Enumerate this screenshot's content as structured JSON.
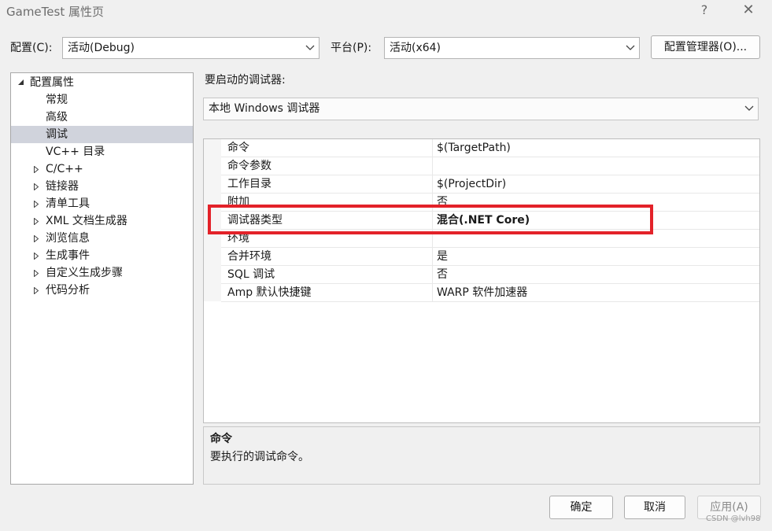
{
  "window": {
    "title": "GameTest 属性页",
    "help_glyph": "?",
    "close_glyph": "✕"
  },
  "toolbar": {
    "config_label": "配置(C):",
    "config_value": "活动(Debug)",
    "platform_label": "平台(P):",
    "platform_value": "活动(x64)",
    "config_manager_label": "配置管理器(O)..."
  },
  "tree": {
    "items": [
      {
        "label": "配置属性",
        "expander": "expanded"
      },
      {
        "label": "常规",
        "expander": "none"
      },
      {
        "label": "高级",
        "expander": "none"
      },
      {
        "label": "调试",
        "expander": "none",
        "selected": true
      },
      {
        "label": "VC++ 目录",
        "expander": "none"
      },
      {
        "label": "C/C++",
        "expander": "collapsed"
      },
      {
        "label": "链接器",
        "expander": "collapsed"
      },
      {
        "label": "清单工具",
        "expander": "collapsed"
      },
      {
        "label": "XML 文档生成器",
        "expander": "collapsed"
      },
      {
        "label": "浏览信息",
        "expander": "collapsed"
      },
      {
        "label": "生成事件",
        "expander": "collapsed"
      },
      {
        "label": "自定义生成步骤",
        "expander": "collapsed"
      },
      {
        "label": "代码分析",
        "expander": "collapsed"
      }
    ]
  },
  "debugger": {
    "launch_label": "要启动的调试器:",
    "selected": "本地 Windows 调试器"
  },
  "properties": [
    {
      "name": "命令",
      "value": "$(TargetPath)"
    },
    {
      "name": "命令参数",
      "value": ""
    },
    {
      "name": "工作目录",
      "value": "$(ProjectDir)"
    },
    {
      "name": "附加",
      "value": "否"
    },
    {
      "name": "调试器类型",
      "value": "混合(.NET Core)",
      "bold": true
    },
    {
      "name": "环境",
      "value": ""
    },
    {
      "name": "合并环境",
      "value": "是"
    },
    {
      "name": "SQL 调试",
      "value": "否"
    },
    {
      "name": "Amp 默认快捷键",
      "value": "WARP 软件加速器"
    }
  ],
  "description": {
    "title": "命令",
    "text": "要执行的调试命令。"
  },
  "buttons": {
    "ok": "确定",
    "cancel": "取消",
    "apply": "应用(A)"
  },
  "watermark": "CSDN @lvh98",
  "colors": {
    "highlight_box": "#e32229",
    "selected_row": "#d0d3dc",
    "background": "#f0f0f0"
  }
}
